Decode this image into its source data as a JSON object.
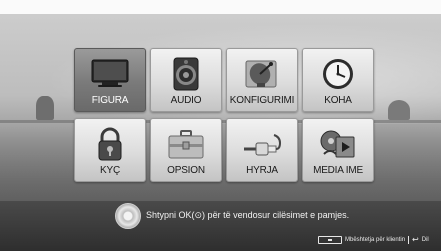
{
  "menu": {
    "tiles": [
      {
        "label": "FIGURA",
        "icon": "tv-icon",
        "selected": true
      },
      {
        "label": "AUDIO",
        "icon": "speaker-icon",
        "selected": false
      },
      {
        "label": "KONFIGURIMI",
        "icon": "satellite-dish-icon",
        "selected": false
      },
      {
        "label": "KOHA",
        "icon": "clock-icon",
        "selected": false
      },
      {
        "label": "KYÇ",
        "icon": "padlock-icon",
        "selected": false
      },
      {
        "label": "OPSION",
        "icon": "toolbox-icon",
        "selected": false
      },
      {
        "label": "HYRJA",
        "icon": "cable-connector-icon",
        "selected": false
      },
      {
        "label": "MEDIA IME",
        "icon": "media-icon",
        "selected": false
      }
    ]
  },
  "footer": {
    "hint": "Shtypni OK(⊙) për të vendosur cilësimet e pamjes.",
    "remote_label": "Mbështetja për klientin",
    "back_label": "Dil"
  }
}
